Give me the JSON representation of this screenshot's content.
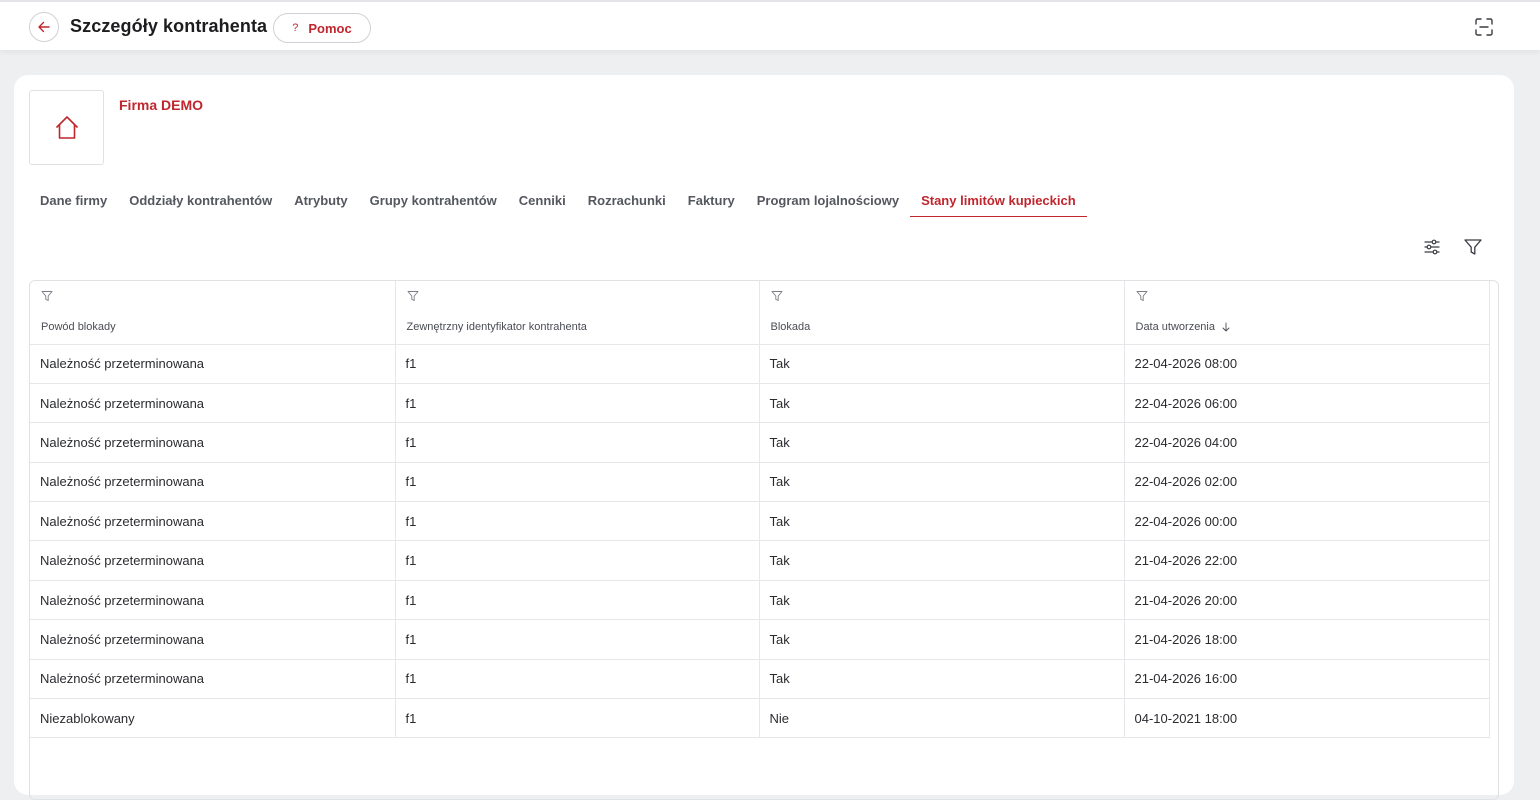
{
  "header": {
    "title": "Szczegóły kontrahenta",
    "help_label": "Pomoc",
    "help_glyph": "?"
  },
  "company": {
    "name": "Firma DEMO"
  },
  "tabs": [
    {
      "label": "Dane firmy",
      "active": false
    },
    {
      "label": "Oddziały kontrahentów",
      "active": false
    },
    {
      "label": "Atrybuty",
      "active": false
    },
    {
      "label": "Grupy kontrahentów",
      "active": false
    },
    {
      "label": "Cenniki",
      "active": false
    },
    {
      "label": "Rozrachunki",
      "active": false
    },
    {
      "label": "Faktury",
      "active": false
    },
    {
      "label": "Program lojalnościowy",
      "active": false
    },
    {
      "label": "Stany limitów kupieckich",
      "active": true
    }
  ],
  "table": {
    "columns": [
      {
        "label": "Powód blokady"
      },
      {
        "label": "Zewnętrzny identyfikator kontrahenta"
      },
      {
        "label": "Blokada"
      },
      {
        "label": "Data utworzenia",
        "sort": "desc"
      }
    ],
    "rows": [
      [
        "Należność przeterminowana",
        "f1",
        "Tak",
        "22-04-2026 08:00"
      ],
      [
        "Należność przeterminowana",
        "f1",
        "Tak",
        "22-04-2026 06:00"
      ],
      [
        "Należność przeterminowana",
        "f1",
        "Tak",
        "22-04-2026 04:00"
      ],
      [
        "Należność przeterminowana",
        "f1",
        "Tak",
        "22-04-2026 02:00"
      ],
      [
        "Należność przeterminowana",
        "f1",
        "Tak",
        "22-04-2026 00:00"
      ],
      [
        "Należność przeterminowana",
        "f1",
        "Tak",
        "21-04-2026 22:00"
      ],
      [
        "Należność przeterminowana",
        "f1",
        "Tak",
        "21-04-2026 20:00"
      ],
      [
        "Należność przeterminowana",
        "f1",
        "Tak",
        "21-04-2026 18:00"
      ],
      [
        "Należność przeterminowana",
        "f1",
        "Tak",
        "21-04-2026 16:00"
      ],
      [
        "Niezablokowany",
        "f1",
        "Nie",
        "04-10-2021 18:00"
      ]
    ]
  },
  "colors": {
    "accent": "#c0262d",
    "background": "#eeeff1",
    "card": "#ffffff",
    "border": "#e0e1e5"
  },
  "icons": {
    "back": "arrow-left-icon",
    "fullscreen": "fullscreen-icon",
    "company_logo": "house-icon",
    "column_settings": "sliders-icon",
    "filter": "filter-icon",
    "sort": "arrow-down-icon"
  }
}
